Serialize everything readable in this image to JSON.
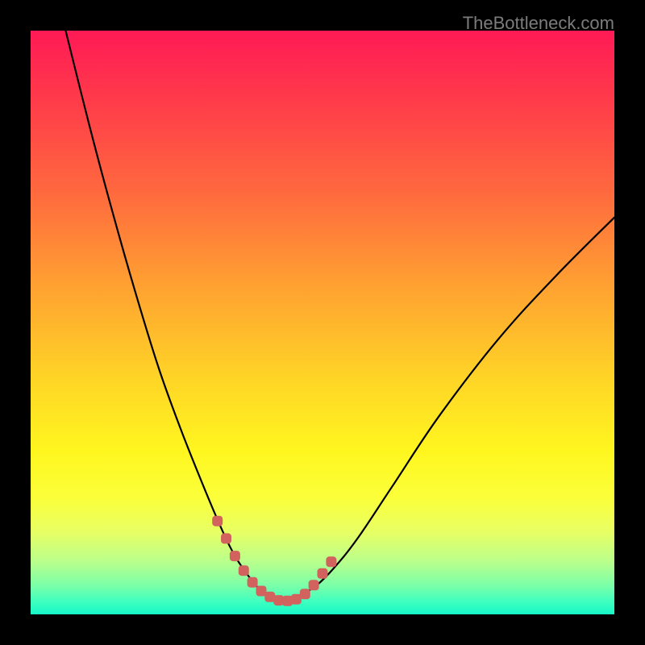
{
  "watermark": "TheBottleneck.com",
  "colors": {
    "frame": "#000000",
    "curve_stroke": "#000000",
    "marker_fill": "#d1625e",
    "gradient_top": "#ff1a55",
    "gradient_bottom": "#17f7c8"
  },
  "chart_data": {
    "type": "line",
    "title": "",
    "xlabel": "",
    "ylabel": "",
    "xlim": [
      0,
      100
    ],
    "ylim": [
      0,
      100
    ],
    "note": "x is horizontal position (% of plot width, left→right); y is vertical position (% of plot height, 0 = bottom = best, 100 = top = worst). Values estimated from pixels.",
    "series": [
      {
        "name": "curve-left",
        "x": [
          6,
          10,
          14,
          18,
          22,
          26,
          30,
          33,
          35,
          37,
          39,
          41,
          43
        ],
        "y": [
          100,
          84,
          69,
          55,
          42,
          31,
          21,
          14,
          10,
          7,
          4.5,
          3,
          2.3
        ]
      },
      {
        "name": "curve-right",
        "x": [
          43,
          46,
          49,
          52,
          56,
          62,
          70,
          80,
          90,
          100
        ],
        "y": [
          2.3,
          3.2,
          5,
          8,
          13,
          22,
          34,
          47,
          58,
          68
        ]
      },
      {
        "name": "markers",
        "x": [
          32,
          33.5,
          35,
          36.5,
          38,
          39.5,
          41,
          42.5,
          44,
          45.5,
          47,
          48.5,
          50,
          51.5
        ],
        "y": [
          16,
          13,
          10,
          7.5,
          5.5,
          4,
          3,
          2.4,
          2.3,
          2.6,
          3.5,
          5,
          7,
          9
        ]
      }
    ]
  }
}
